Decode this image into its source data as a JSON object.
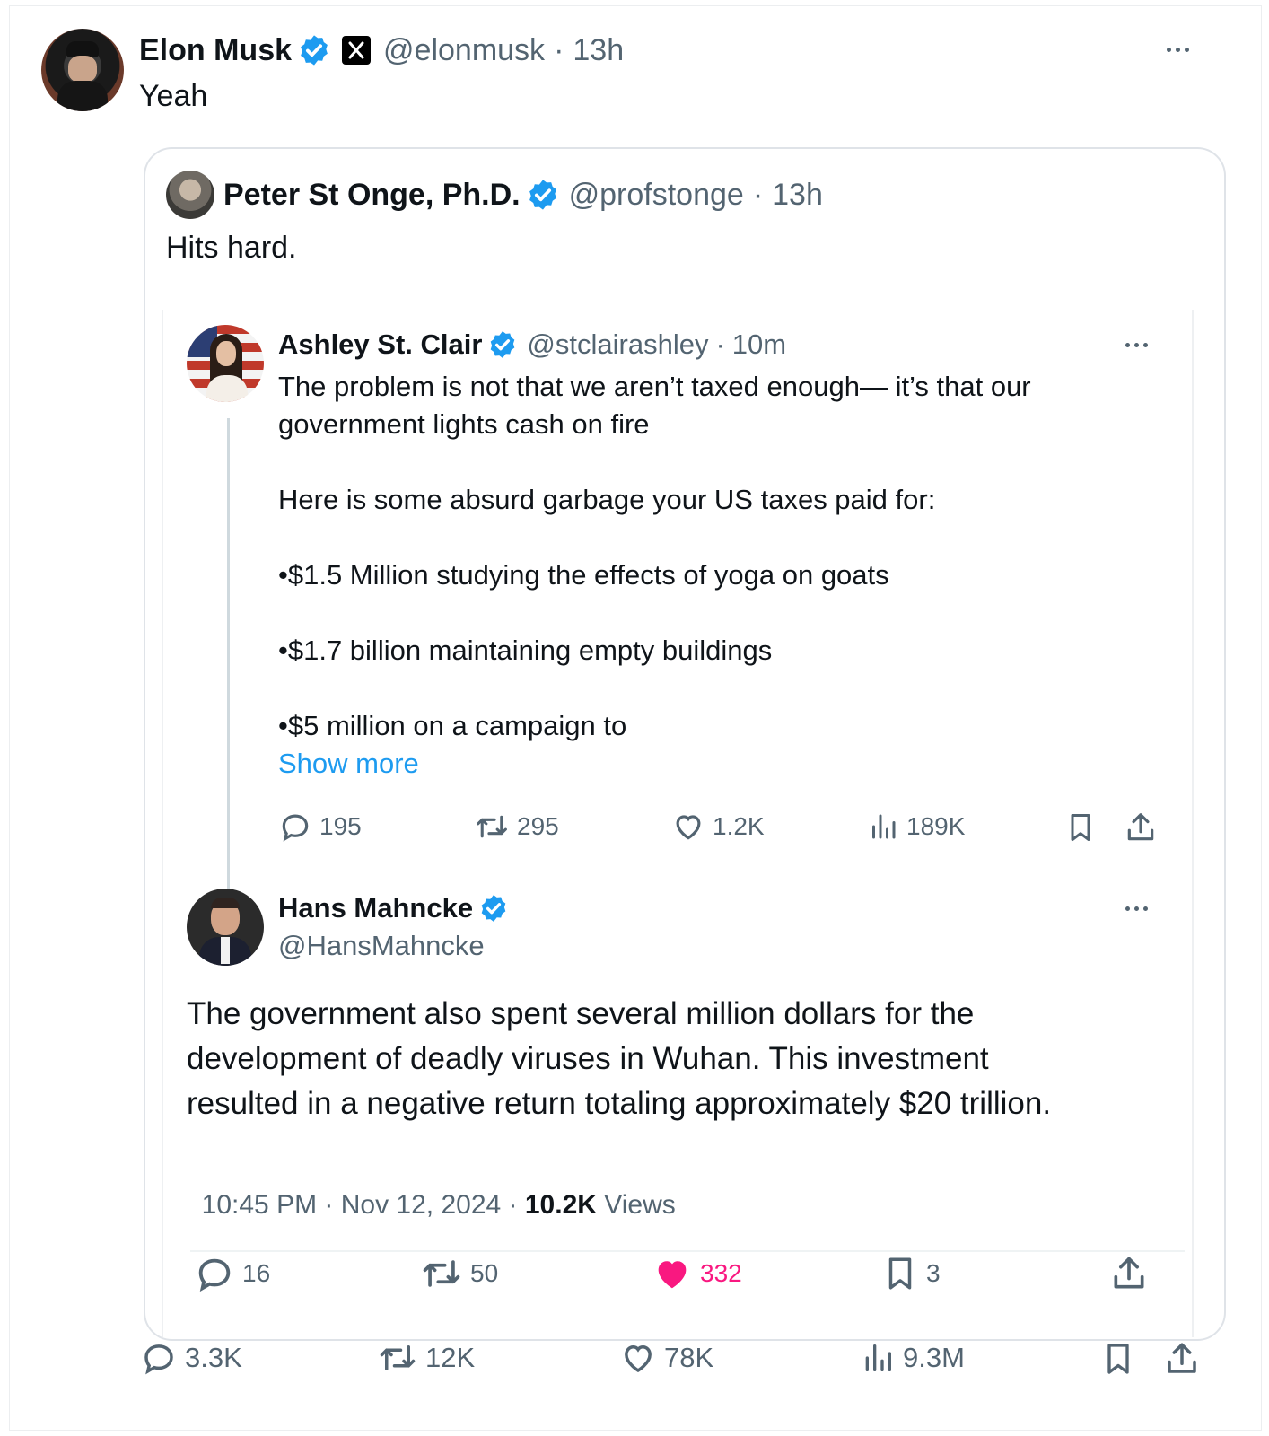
{
  "main_tweet": {
    "author": "Elon Musk",
    "handle": "@elonmusk",
    "separator": "·",
    "time": "13h",
    "text": "Yeah",
    "affiliate_icon": "x-logo-icon",
    "actions": {
      "replies": "3.3K",
      "reposts": "12K",
      "likes": "78K",
      "views": "9.3M"
    }
  },
  "quoted_tweet": {
    "author": "Peter St Onge, Ph.D.",
    "handle": "@profstonge",
    "separator": "·",
    "time": "13h",
    "text": "Hits hard."
  },
  "embedded_thread": {
    "first": {
      "author": "Ashley St. Clair",
      "handle": "@stclairashley",
      "separator": "·",
      "time": "10m",
      "lines": [
        "The problem is not that we aren’t taxed enough— it’s that our",
        "government lights cash on fire",
        "Here is some absurd garbage your US taxes paid for:",
        "•$1.5 Million studying the effects of yoga on goats",
        "•$1.7 billion maintaining empty buildings",
        "•$5 million on a campaign to"
      ],
      "show_more": "Show more",
      "actions": {
        "replies": "195",
        "reposts": "295",
        "likes": "1.2K",
        "views": "189K"
      }
    },
    "reply": {
      "author": "Hans Mahncke",
      "handle": "@HansMahncke",
      "lines": [
        "The government also spent several million dollars for the",
        "development of deadly viruses in Wuhan. This investment",
        "resulted in a negative return totaling approximately $20 trillion."
      ],
      "timestamp": "10:45 PM · Nov 12, 2024 · ",
      "views_count": "10.2K",
      "views_label": " Views",
      "actions": {
        "replies": "16",
        "reposts": "50",
        "likes": "332",
        "bookmarks": "3"
      }
    }
  },
  "colors": {
    "verified": "#1d9bf0",
    "like_active": "#f91880",
    "muted": "#536471",
    "link": "#1d9bf0"
  }
}
